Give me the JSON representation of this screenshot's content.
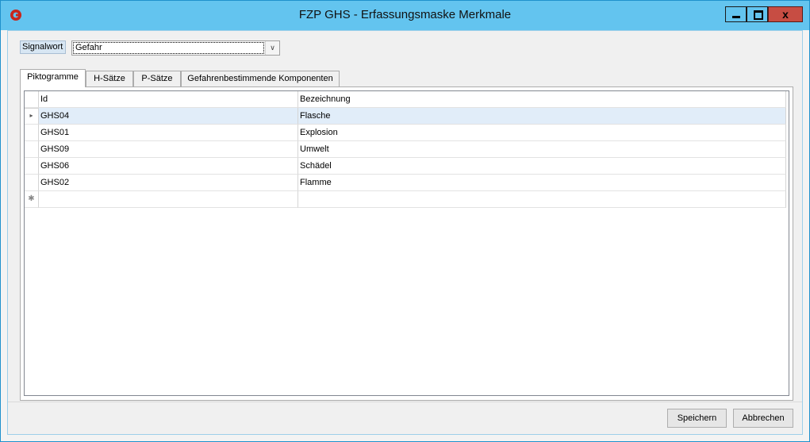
{
  "window": {
    "title": "FZP GHS - Erfassungsmaske Merkmale",
    "close_glyph": "x"
  },
  "signalwort": {
    "label": "Signalwort",
    "value": "Gefahr",
    "arrow_glyph": "∨"
  },
  "tabs": [
    {
      "label": "Piktogramme",
      "active": true
    },
    {
      "label": "H-Sätze",
      "active": false
    },
    {
      "label": "P-Sätze",
      "active": false
    },
    {
      "label": "Gefahrenbestimmende Komponenten",
      "active": false
    }
  ],
  "grid": {
    "columns": [
      "Id",
      "Bezeichnung"
    ],
    "rows": [
      {
        "id": "GHS04",
        "bezeichnung": "Flasche"
      },
      {
        "id": "GHS01",
        "bezeichnung": "Explosion"
      },
      {
        "id": "GHS09",
        "bezeichnung": "Umwelt"
      },
      {
        "id": "GHS06",
        "bezeichnung": "Schädel"
      },
      {
        "id": "GHS02",
        "bezeichnung": "Flamme"
      }
    ],
    "current_row_marker": "▸",
    "new_row_marker": "✱"
  },
  "buttons": {
    "save": "Speichern",
    "cancel": "Abbrechen"
  },
  "icons": {
    "app": "app-logo-icon",
    "minimize": "minimize-icon",
    "maximize": "maximize-icon",
    "close": "close-icon"
  },
  "colors": {
    "titlebar": "#63c4ef",
    "close_button": "#c74d43",
    "selected_row": "#e1edf9"
  }
}
